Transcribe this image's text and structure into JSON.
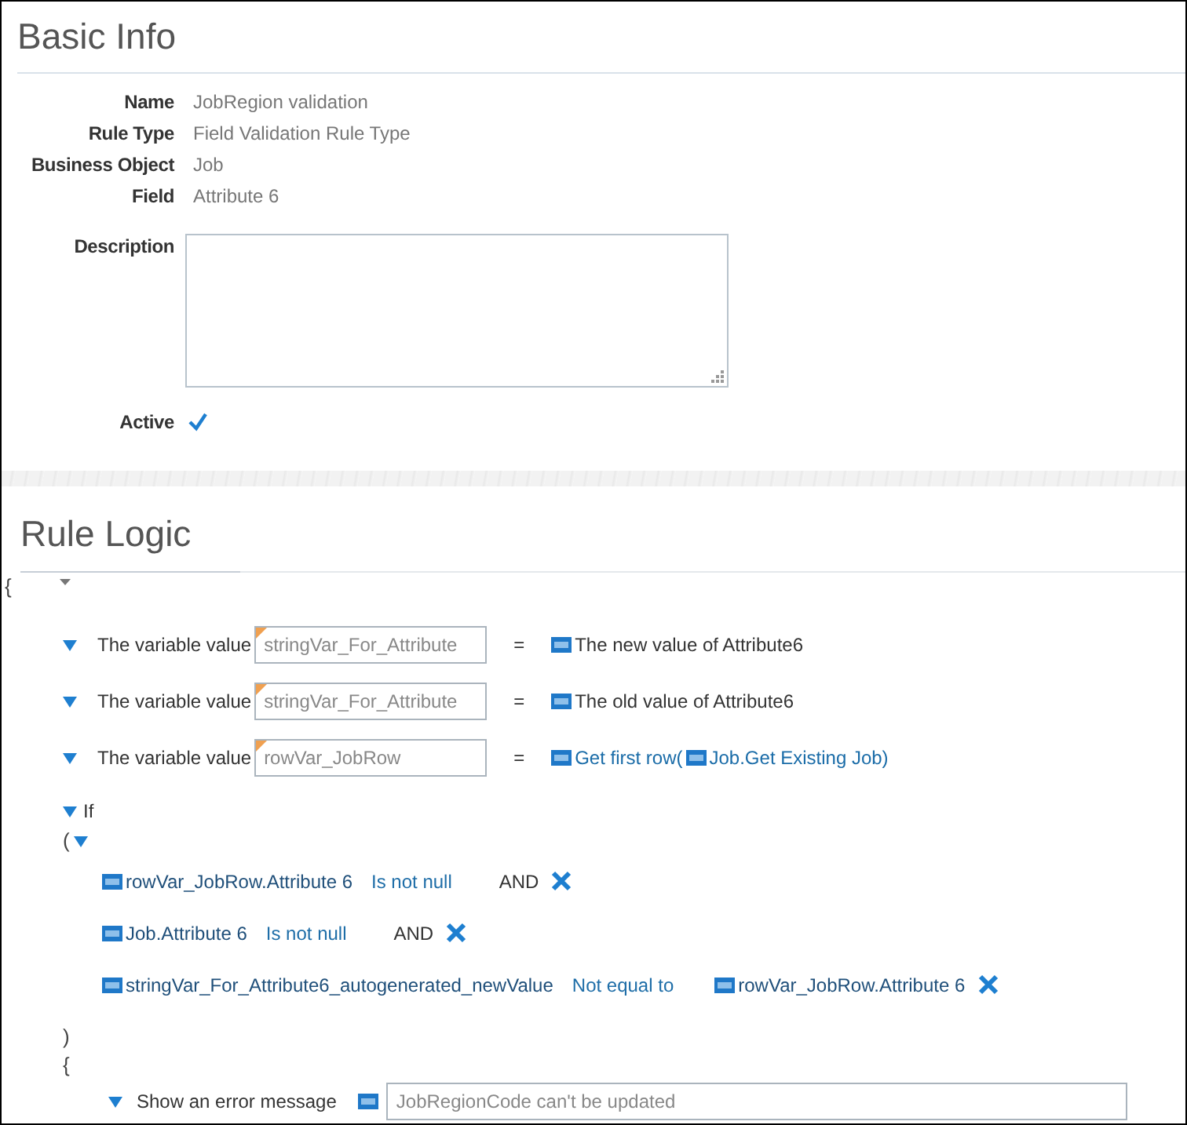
{
  "basic_info": {
    "title": "Basic Info",
    "fields": [
      {
        "label": "Name",
        "value": "JobRegion validation"
      },
      {
        "label": "Rule Type",
        "value": "Field Validation Rule Type"
      },
      {
        "label": "Business Object",
        "value": "Job"
      },
      {
        "label": "Field",
        "value": "Attribute 6"
      }
    ],
    "description": {
      "label": "Description"
    },
    "active": {
      "label": "Active",
      "checked": true
    }
  },
  "rule_logic": {
    "title": "Rule Logic",
    "open_brace": "{",
    "assignments": [
      {
        "label": "The variable value",
        "variable": "stringVar_For_Attribute",
        "equals": "=",
        "value_parts": [
          {
            "text": "The new value of Attribute6",
            "link": false
          }
        ]
      },
      {
        "label": "The variable value",
        "variable": "stringVar_For_Attribute",
        "equals": "=",
        "value_parts": [
          {
            "text": "The old value of Attribute6",
            "link": false
          }
        ]
      },
      {
        "label": "The variable value",
        "variable": "rowVar_JobRow",
        "equals": "=",
        "value_parts": [
          {
            "text": "Get first row(",
            "link": true
          },
          {
            "text": "Job.Get Existing Job)",
            "link": true
          }
        ]
      }
    ],
    "if": {
      "label": "If",
      "open_paren": "(",
      "conditions": [
        {
          "left": "rowVar_JobRow.Attribute 6",
          "operator": "Is not null",
          "conjunction": "AND"
        },
        {
          "left": "Job.Attribute 6",
          "operator": "Is not null",
          "conjunction": "AND"
        },
        {
          "left": "stringVar_For_Attribute6_autogenerated_newValue",
          "operator": "Not equal to",
          "right": "rowVar_JobRow.Attribute 6"
        }
      ],
      "close_paren": ")",
      "open_brace": "{",
      "action": {
        "label": "Show an error message",
        "value": "JobRegionCode can't be updated"
      }
    }
  }
}
